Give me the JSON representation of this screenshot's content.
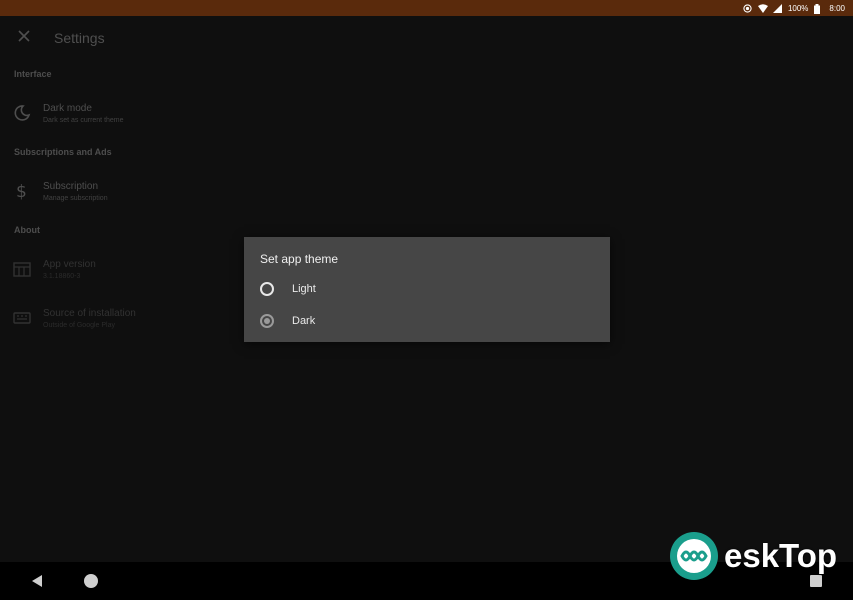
{
  "status_bar": {
    "battery": "100%",
    "time": "8:00",
    "icons": [
      "record-icon",
      "wifi-icon",
      "signal-icon",
      "battery-icon"
    ]
  },
  "toolbar": {
    "title": "Settings",
    "close_icon": "close-icon"
  },
  "sections": {
    "interface": {
      "header": "Interface"
    },
    "subscriptions": {
      "header": "Subscriptions and Ads"
    },
    "about": {
      "header": "About"
    }
  },
  "items": {
    "dark_mode": {
      "title": "Dark mode",
      "summary": "Dark set as current theme",
      "icon": "moon-icon"
    },
    "subscription": {
      "title": "Subscription",
      "summary": "Manage subscription",
      "icon": "dollar-icon"
    },
    "app_version": {
      "title": "App version",
      "summary": "3.1.18860-3",
      "icon": "calendar-icon"
    },
    "source": {
      "title": "Source of installation",
      "summary": "Outside of Google Play",
      "icon": "keyboard-icon"
    }
  },
  "dialog": {
    "title": "Set app theme",
    "options": [
      {
        "label": "Light",
        "selected": false
      },
      {
        "label": "Dark",
        "selected": true
      }
    ]
  },
  "watermark": {
    "text": "eskTop"
  },
  "colors": {
    "status_bar": "#5a2a0c",
    "background": "#121212",
    "dialog": "#464646"
  }
}
